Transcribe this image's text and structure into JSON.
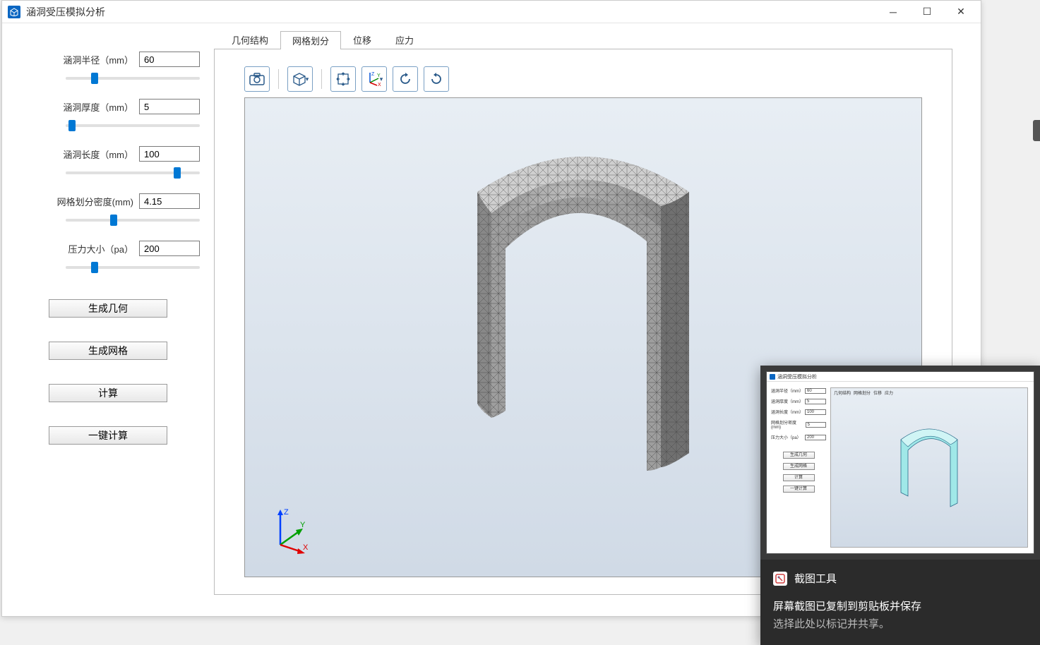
{
  "window": {
    "title": "涵洞受压模拟分析"
  },
  "sidebar": {
    "params": [
      {
        "label": "涵洞半径（mm）",
        "value": "60",
        "slider": 20
      },
      {
        "label": "涵洞厚度（mm）",
        "value": "5",
        "slider": 2
      },
      {
        "label": "涵洞长度（mm）",
        "value": "100",
        "slider": 85
      },
      {
        "label": "网格划分密度(mm)",
        "value": "4.15",
        "slider": 35
      },
      {
        "label": "压力大小（pa）",
        "value": "200",
        "slider": 20
      }
    ],
    "buttons": [
      "生成几何",
      "生成网格",
      "计算",
      "一键计算"
    ]
  },
  "tabs": {
    "items": [
      "几何结构",
      "网格划分",
      "位移",
      "应力"
    ],
    "active_index": 1
  },
  "toolbar_icons": [
    "camera-icon",
    "cube-icon",
    "fit-icon",
    "axes-icon",
    "rotate-left-icon",
    "rotate-right-icon"
  ],
  "viewport": {
    "axes": {
      "x": "X",
      "y": "Y",
      "z": "Z"
    }
  },
  "notification": {
    "app": "截图工具",
    "line1": "屏幕截图已复制到剪贴板并保存",
    "line2": "选择此处以标记并共享。",
    "thumb": {
      "title": "涵洞受压模拟分析",
      "tabs": [
        "几何结构",
        "网格划分",
        "位移",
        "应力"
      ],
      "params": [
        {
          "label": "涵洞半径（mm）",
          "value": "60"
        },
        {
          "label": "涵洞厚度（mm）",
          "value": "5"
        },
        {
          "label": "涵洞长度（mm）",
          "value": "100"
        },
        {
          "label": "网格划分密度(mm)",
          "value": "5"
        },
        {
          "label": "压力大小（pa）",
          "value": "200"
        }
      ],
      "buttons": [
        "生成几何",
        "生成网格",
        "计算",
        "一键计算"
      ]
    }
  }
}
